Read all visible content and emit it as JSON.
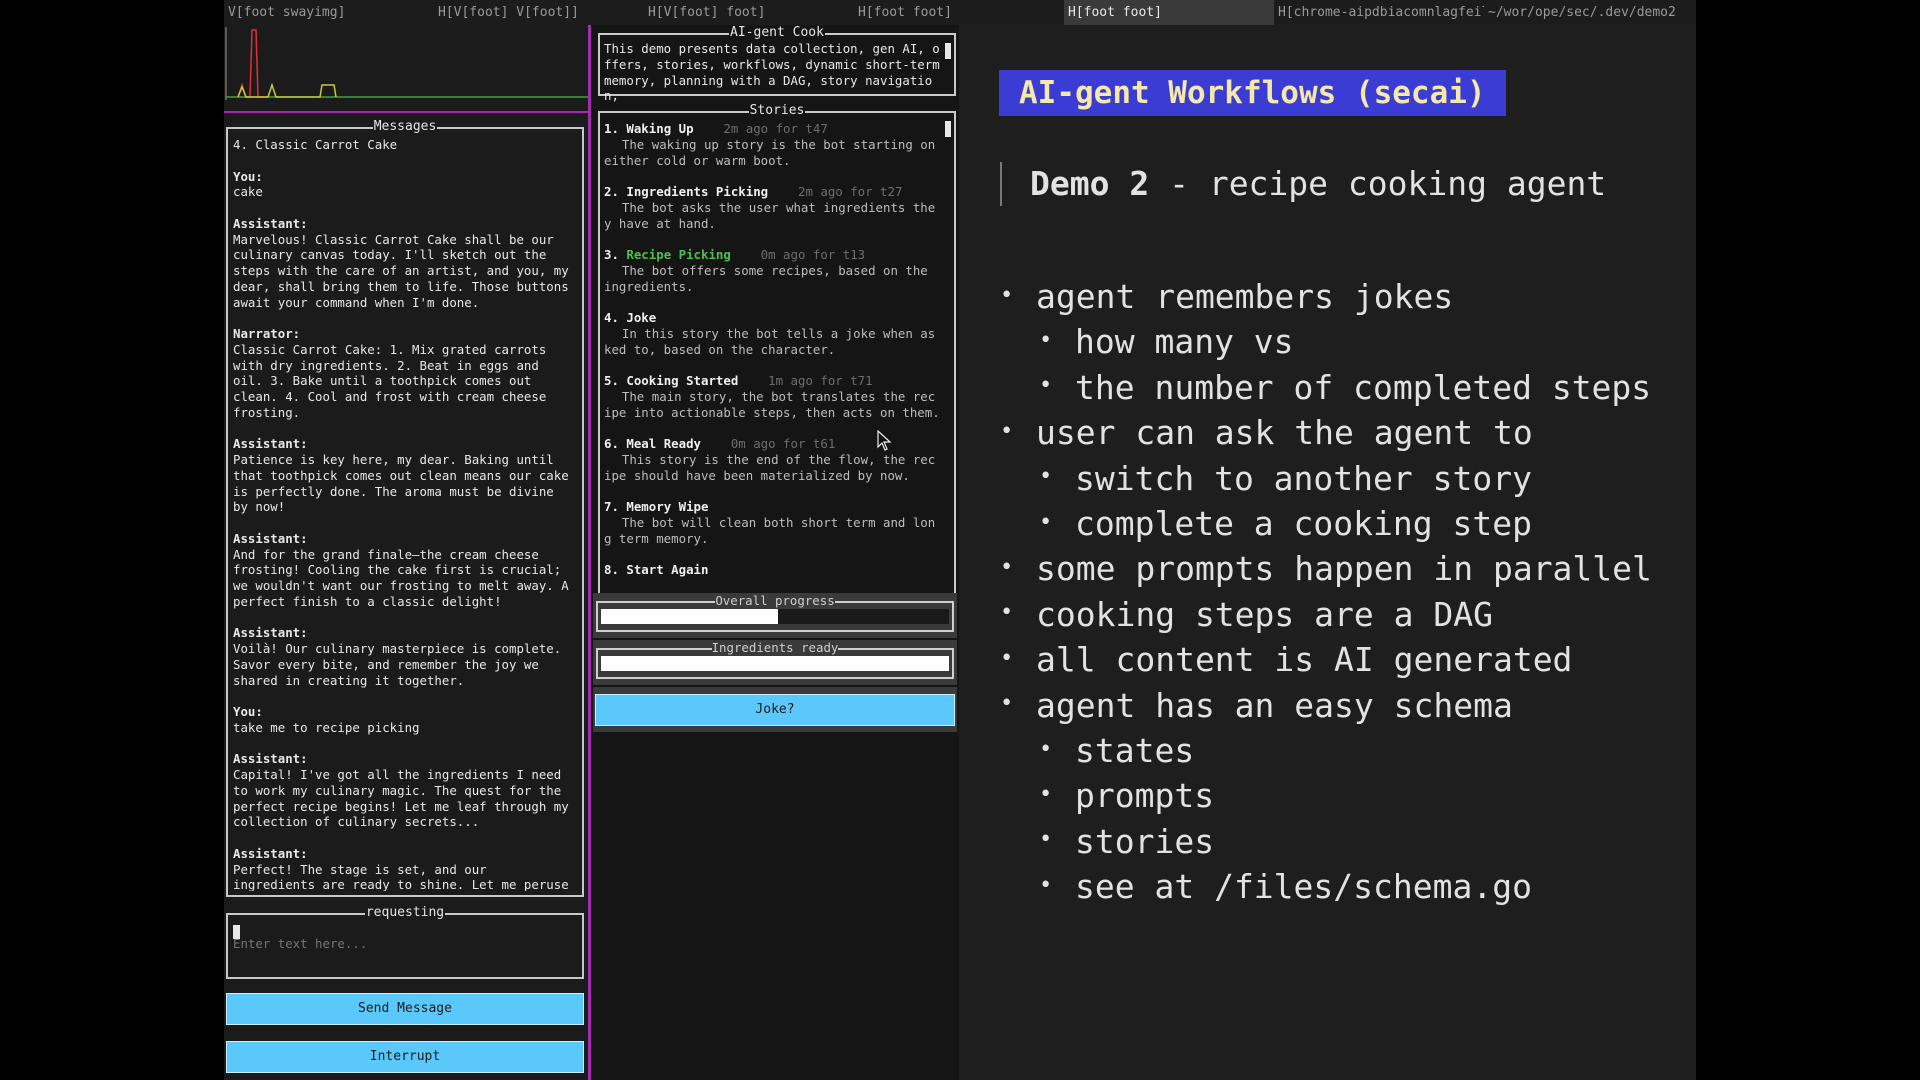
{
  "tabs": [
    {
      "label": "V[foot swayimg]",
      "width": 210
    },
    {
      "label": "H[V[foot] V[foot]]",
      "width": 210
    },
    {
      "label": "H[V[foot] foot]",
      "width": 210
    },
    {
      "label": "H[foot foot]",
      "width": 210
    },
    {
      "label": "H[foot foot]",
      "width": 210,
      "active": true
    },
    {
      "label": "H[chrome-aipdbiacomnlagfeil",
      "width": 210
    },
    {
      "label": "~/wor/ope/sec/.dev/demo2",
      "width": 212
    }
  ],
  "messages": {
    "title": "Messages",
    "items": [
      {
        "role": "",
        "text": "4. Classic Carrot Cake"
      },
      {
        "role": "You:",
        "text": "cake"
      },
      {
        "role": "Assistant:",
        "text": "Marvelous! Classic Carrot Cake shall be our culinary canvas today. I'll sketch out the steps with the care of an artist, and you, my dear, shall bring them to life. Those buttons await your command when I'm done."
      },
      {
        "role": "Narrator:",
        "text": "Classic Carrot Cake: 1. Mix grated carrots with dry ingredients. 2. Beat in eggs and oil. 3. Bake until a toothpick comes out clean. 4. Cool and frost with cream cheese frosting."
      },
      {
        "role": "Assistant:",
        "text": "Patience is key here, my dear. Baking until that toothpick comes out clean means our cake is perfectly done. The aroma must be divine by now!"
      },
      {
        "role": "Assistant:",
        "text": "And for the grand finale—the cream cheese frosting! Cooling the cake first is crucial; we wouldn't want our frosting to melt away. A perfect finish to a classic delight!"
      },
      {
        "role": "Assistant:",
        "text": "Voilà! Our culinary masterpiece is complete. Savor every bite, and remember the joy we shared in creating it together."
      },
      {
        "role": "You:",
        "text": "take me to recipe picking"
      },
      {
        "role": "Assistant:",
        "text": "Capital! I've got all the ingredients I need to work my culinary magic. The quest for the perfect recipe begins! Let me leaf through my collection of culinary secrets..."
      },
      {
        "role": "Assistant:",
        "text": "Perfect! The stage is set, and our ingredients are ready to shine. Let me peruse my culinary tomes to see what delights we can conjure up..."
      }
    ]
  },
  "request": {
    "title": "requesting",
    "placeholder": "Enter text here..."
  },
  "buttons": {
    "send": "Send Message",
    "interrupt": "Interrupt",
    "joke": "Joke?"
  },
  "cook": {
    "title": "AI-gent Cook",
    "text": "This demo presents data collection, gen AI, offers, stories, workflows, dynamic short-term memory, planning with a DAG, story navigation,"
  },
  "stories": {
    "title": "Stories",
    "items": [
      {
        "num": "1.",
        "title": "Waking Up",
        "meta": "2m ago for t47",
        "desc": "The waking up story is the bot starting on either cold or warm boot."
      },
      {
        "num": "2.",
        "title": "Ingredients Picking",
        "meta": "2m ago for t27",
        "desc": "The bot asks the user what ingredients they have at hand."
      },
      {
        "num": "3.",
        "title": "Recipe Picking",
        "meta": "0m ago for t13",
        "desc": "The bot offers some recipes, based on the ingredients.",
        "active": true
      },
      {
        "num": "4.",
        "title": "Joke",
        "meta": "",
        "desc": "In this story the bot tells a joke when asked to, based on the character."
      },
      {
        "num": "5.",
        "title": "Cooking Started",
        "meta": "1m ago for t71",
        "desc": "The main story, the bot translates the recipe into actionable steps, then acts on them."
      },
      {
        "num": "6.",
        "title": "Meal Ready",
        "meta": "0m ago for t61",
        "desc": "This story is the end of the flow, the recipe should have been materialized by now."
      },
      {
        "num": "7.",
        "title": "Memory Wipe",
        "meta": "",
        "desc": "The bot will clean both short term and long term memory."
      },
      {
        "num": "8.",
        "title": "Start Again",
        "meta": "",
        "desc": ""
      }
    ]
  },
  "progress": {
    "overall": {
      "label": "Overall progress",
      "value": 0.51
    },
    "ingredients": {
      "label": "Ingredients ready",
      "value": 1.0
    }
  },
  "slide": {
    "title": "AI-gent Workflows (secai)",
    "subtitle_bold": "Demo 2",
    "subtitle_rest": " - recipe cooking agent",
    "bullets": [
      {
        "level": 0,
        "text": "agent remembers jokes"
      },
      {
        "level": 1,
        "text": "how many vs"
      },
      {
        "level": 1,
        "text": "the number of completed steps"
      },
      {
        "level": 0,
        "text": "user can ask the agent to"
      },
      {
        "level": 1,
        "text": "switch to another story"
      },
      {
        "level": 1,
        "text": "complete a cooking step"
      },
      {
        "level": 0,
        "text": "some prompts happen in parallel"
      },
      {
        "level": 0,
        "text": "cooking steps are a DAG"
      },
      {
        "level": 0,
        "text": "all content is AI generated"
      },
      {
        "level": 0,
        "text": "agent has an easy schema"
      },
      {
        "level": 1,
        "text": "states"
      },
      {
        "level": 1,
        "text": "prompts"
      },
      {
        "level": 1,
        "text": "stories"
      },
      {
        "level": 1,
        "text": "see at /files/schema.go"
      }
    ]
  },
  "colors": {
    "border_accent": "#a22bb0",
    "button": "#5ac8fa",
    "active_story": "#4cc04c",
    "slide_title_bg": "#3b3cd4",
    "slide_title_fg": "#f4e9a8"
  }
}
